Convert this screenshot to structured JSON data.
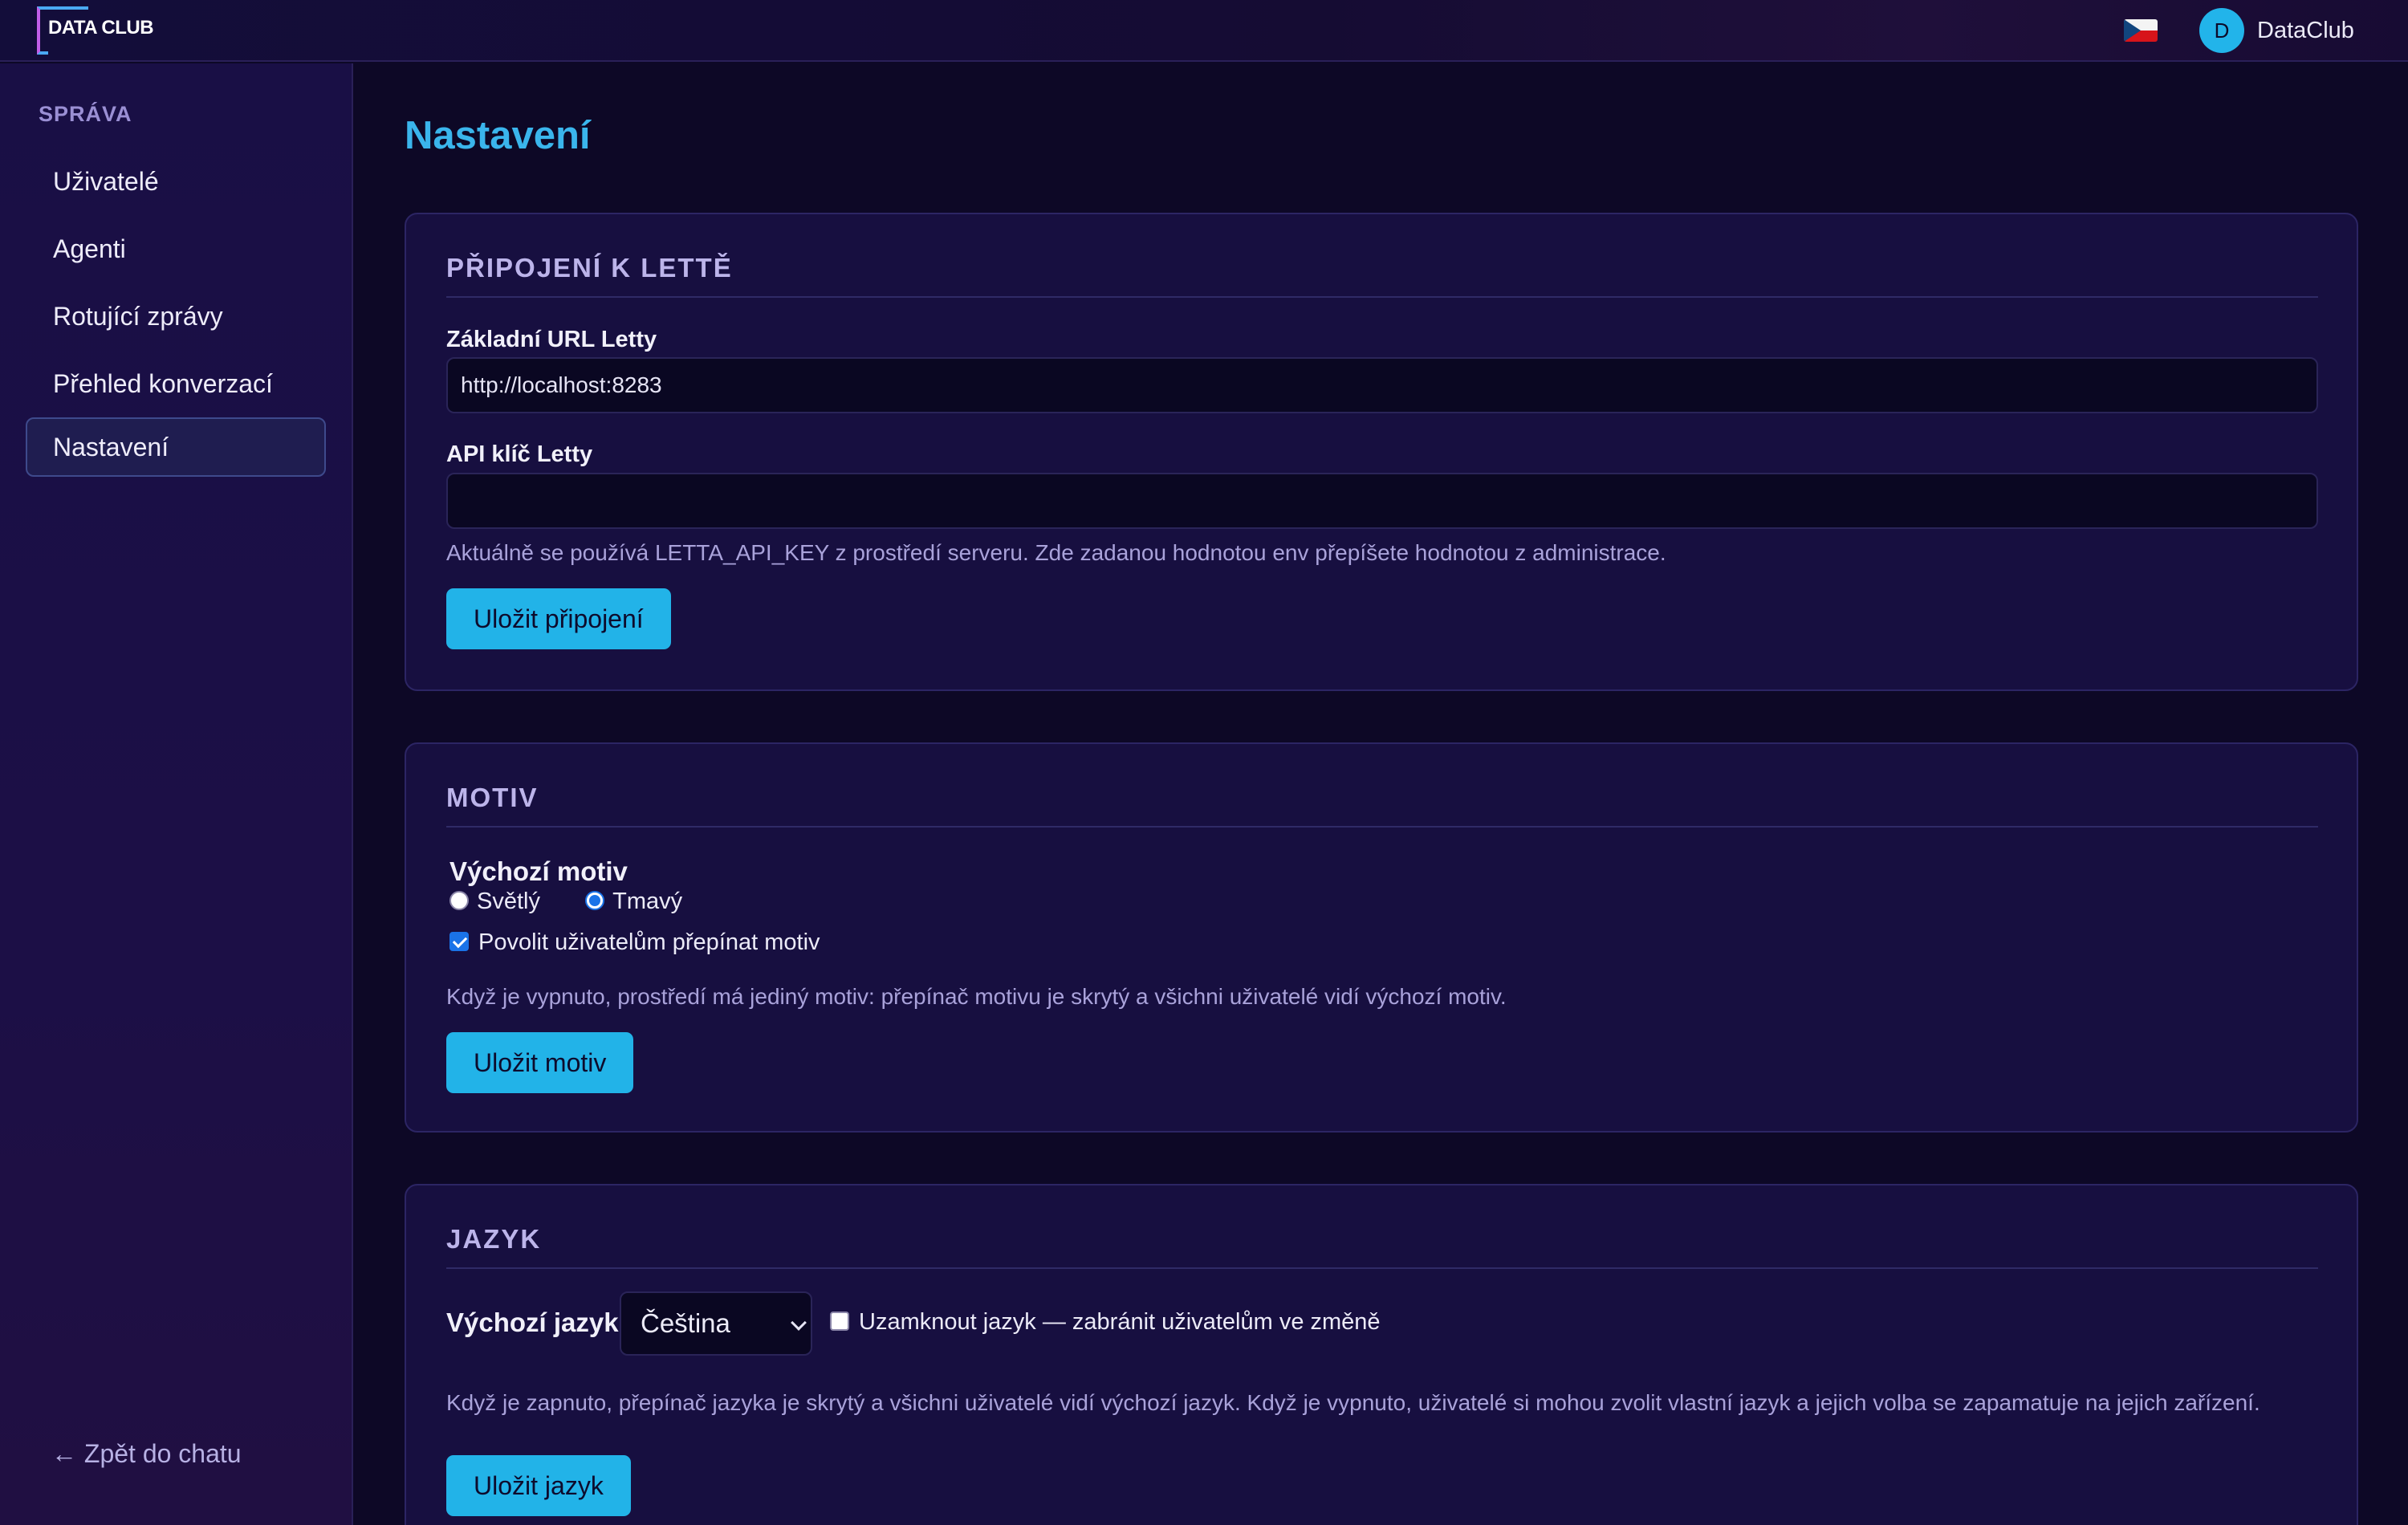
{
  "header": {
    "logo_text": "DATA CLUB",
    "language_flag": "czech-flag",
    "user": {
      "avatar_letter": "D",
      "name": "DataClub"
    }
  },
  "sidebar": {
    "section_title": "SPRÁVA",
    "items": [
      {
        "label": "Uživatelé"
      },
      {
        "label": "Agenti"
      },
      {
        "label": "Rotující zprávy"
      },
      {
        "label": "Přehled konverzací"
      },
      {
        "label": "Nastavení",
        "active": true
      }
    ],
    "back_link": "← Zpět do chatu"
  },
  "main": {
    "page_title": "Nastavení",
    "connection": {
      "title": "PŘIPOJENÍ K LETTĚ",
      "url_label": "Základní URL Letty",
      "url_value": "http://localhost:8283",
      "api_key_label": "API klíč Letty",
      "api_key_value": "",
      "hint": "Aktuálně se používá LETTA_API_KEY z prostředí serveru. Zde zadanou hodnotou env přepíšete hodnotou z administrace.",
      "save_label": "Uložit připojení"
    },
    "theme": {
      "title": "MOTIV",
      "legend": "Výchozí motiv",
      "options": [
        {
          "label": "Světlý",
          "selected": false
        },
        {
          "label": "Tmavý",
          "selected": true
        }
      ],
      "allow_switch_label": "Povolit uživatelům přepínat motiv",
      "allow_switch_checked": true,
      "hint": "Když je vypnuto, prostředí má jediný motiv: přepínač motivu je skrytý a všichni uživatelé vidí výchozí motiv.",
      "save_label": "Uložit motiv"
    },
    "language": {
      "title": "JAZYK",
      "default_label": "Výchozí jazyk",
      "selected_language": "Čeština",
      "lock_label": "Uzamknout jazyk — zabránit uživatelům ve změně",
      "lock_checked": false,
      "hint": "Když je zapnuto, přepínač jazyka je skrytý a všichni uživatelé vidí výchozí jazyk. Když je vypnuto, uživatelé si mohou zvolit vlastní jazyk a jejich volba se zapamatuje na jejich zařízení.",
      "save_label": "Uložit jazyk"
    }
  },
  "colors": {
    "accent": "#22b3e8",
    "title": "#3ab5ec",
    "background": "#0d0826",
    "card": "#170f40"
  }
}
